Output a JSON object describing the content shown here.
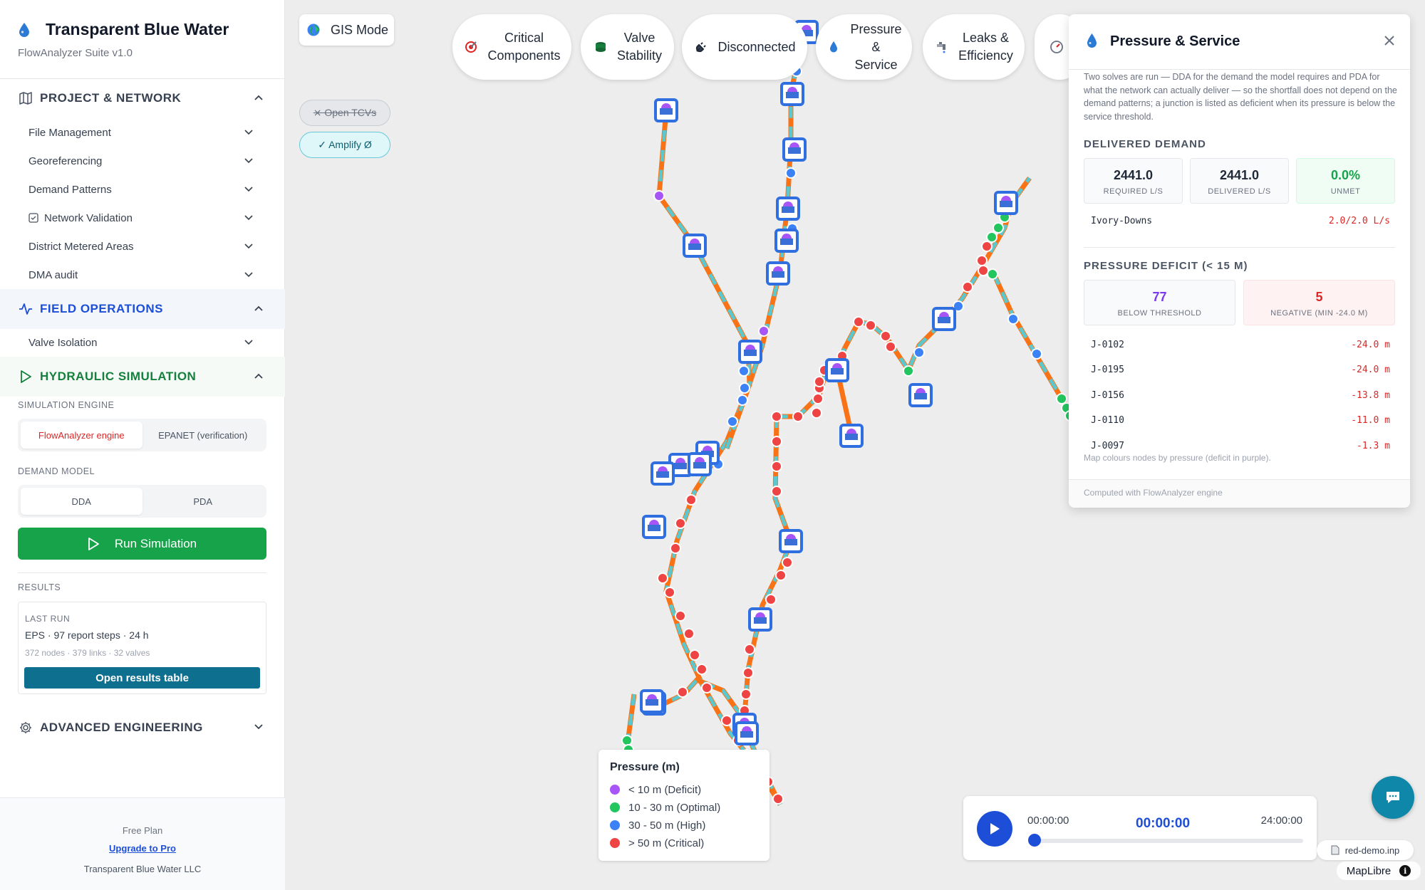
{
  "app": {
    "title": "Transparent Blue Water",
    "subtitle": "FlowAnalyzer Suite v1.0"
  },
  "sidebar": {
    "project": {
      "title": "PROJECT & NETWORK",
      "items": [
        "File Management",
        "Georeferencing",
        "Demand Patterns",
        "Network Validation",
        "District Metered Areas",
        "DMA audit"
      ]
    },
    "field": {
      "title": "FIELD OPERATIONS",
      "items": [
        "Valve Isolation"
      ]
    },
    "hydraulic": {
      "title": "HYDRAULIC SIMULATION",
      "engine_label": "SIMULATION ENGINE",
      "engine_options": [
        "FlowAnalyzer engine",
        "EPANET (verification)"
      ],
      "engine_selected": "FlowAnalyzer engine",
      "demand_label": "DEMAND MODEL",
      "demand_options": [
        "DDA",
        "PDA"
      ],
      "demand_selected": "DDA",
      "run_label": "Run Simulation",
      "results_label": "RESULTS",
      "last_run_label": "LAST RUN",
      "last_run_main": "EPS · 97 report steps · 24 h",
      "last_run_sub": "372 nodes · 379 links · 32 valves",
      "open_results": "Open results table"
    },
    "advanced": {
      "title": "ADVANCED ENGINEERING"
    },
    "footer": {
      "plan": "Free Plan",
      "upgrade": "Upgrade to Pro",
      "company": "Transparent Blue Water LLC"
    }
  },
  "map": {
    "gis_mode": "GIS Mode",
    "pills": [
      {
        "label_lines": [
          "Critical",
          "Components"
        ],
        "icon": "target-icon"
      },
      {
        "label_lines": [
          "Valve",
          "Stability"
        ],
        "icon": "valve-icon"
      },
      {
        "label_lines": [
          "Disconnected"
        ],
        "icon": "plug-icon"
      },
      {
        "label_lines": [
          "Pressure",
          "&",
          "Service"
        ],
        "icon": "droplet-icon"
      },
      {
        "label_lines": [
          "Leaks &",
          "Efficiency"
        ],
        "icon": "faucet-icon"
      }
    ],
    "toggles": {
      "open_tcvs": "⨯ Open TCVs",
      "amplify": "✓ Amplify Ø"
    },
    "legend": {
      "title": "Pressure (m)",
      "items": [
        {
          "label": "< 10 m (Deficit)",
          "color": "#a855f7"
        },
        {
          "label": "10 - 30 m (Optimal)",
          "color": "#22c55e"
        },
        {
          "label": "30 - 50 m (High)",
          "color": "#3b82f6"
        },
        {
          "label": "> 50 m (Critical)",
          "color": "#ef4444"
        }
      ]
    },
    "timeline": {
      "start": "00:00:00",
      "current": "00:00:00",
      "end": "24:00:00",
      "progress": 0
    },
    "file_name": "red-demo.inp",
    "attribution": "MapLibre"
  },
  "panel": {
    "title": "Pressure & Service",
    "description": "Two solves are run — DDA for the demand the model requires and PDA for what the network can actually deliver — so the shortfall does not depend on the demand patterns; a junction is listed as deficient when its pressure is below the service threshold.",
    "delivered": {
      "heading": "DELIVERED DEMAND",
      "required": "2441.0",
      "required_label": "REQUIRED L/S",
      "delivered": "2441.0",
      "delivered_label": "DELIVERED L/S",
      "unmet": "0.0%",
      "unmet_label": "UNMET",
      "zone_name": "Ivory-Downs",
      "zone_value": "2.0/2.0 L/s"
    },
    "deficit": {
      "heading": "PRESSURE DEFICIT (< 15 M)",
      "below": "77",
      "below_label": "BELOW THRESHOLD",
      "negative": "5",
      "negative_label": "NEGATIVE (MIN -24.0 M)",
      "rows": [
        {
          "id": "J-0102",
          "value": "-24.0 m"
        },
        {
          "id": "J-0195",
          "value": "-24.0 m"
        },
        {
          "id": "J-0156",
          "value": "-13.8 m"
        },
        {
          "id": "J-0110",
          "value": "-11.0 m"
        },
        {
          "id": "J-0097",
          "value": "-1.3 m"
        }
      ]
    },
    "note": "Map colours nodes by pressure (deficit in purple).",
    "footer": "Computed with FlowAnalyzer engine"
  },
  "colors": {
    "accent": "#1d4ed8",
    "run": "#16a34a",
    "field": "#1d4ed8",
    "hydraulic": "#15803d",
    "pipe": "#f97316",
    "pipe_stripe": "#5bc8d0"
  }
}
